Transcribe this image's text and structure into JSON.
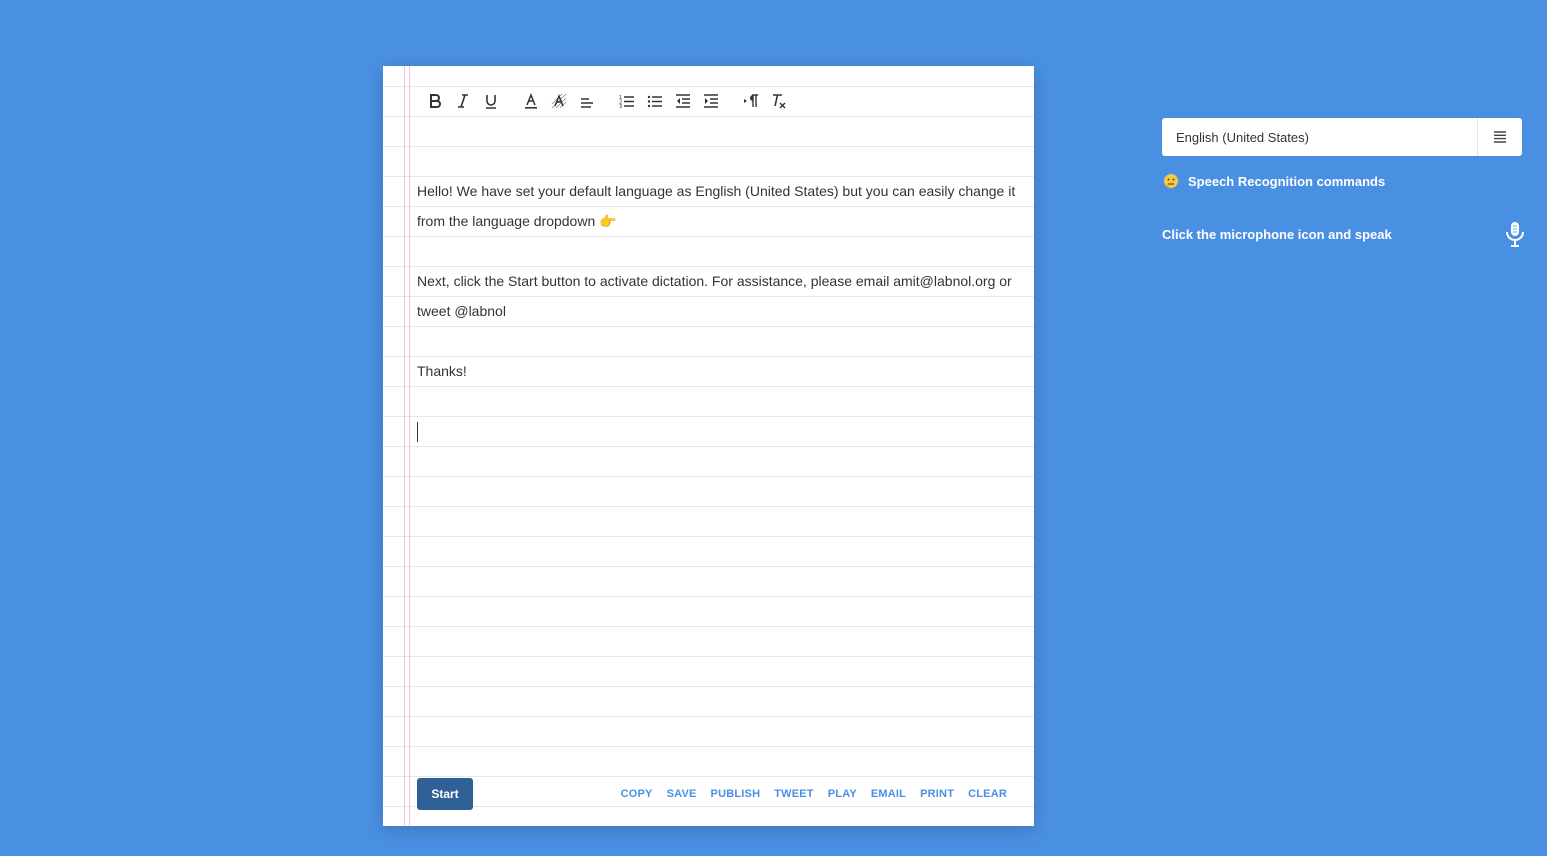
{
  "toolbar": {
    "buttons": [
      {
        "name": "bold-icon"
      },
      {
        "name": "italic-icon"
      },
      {
        "name": "underline-icon"
      },
      {
        "name": "font-color-icon"
      },
      {
        "name": "background-color-icon"
      },
      {
        "name": "align-icon"
      },
      {
        "name": "ordered-list-icon"
      },
      {
        "name": "bullet-list-icon"
      },
      {
        "name": "outdent-icon"
      },
      {
        "name": "indent-icon"
      },
      {
        "name": "text-direction-icon"
      },
      {
        "name": "clear-format-icon"
      }
    ]
  },
  "editor": {
    "paragraph1": "Hello! We have set your default language as English (United States) but you can easily change it from the language dropdown",
    "paragraph1_emoji": "👉",
    "paragraph2": "Next, click the Start button to activate dictation. For assistance, please email amit@labnol.org or tweet @labnol",
    "paragraph3": "Thanks!"
  },
  "bottom": {
    "start_label": "Start",
    "actions": [
      "COPY",
      "SAVE",
      "PUBLISH",
      "TWEET",
      "PLAY",
      "EMAIL",
      "PRINT",
      "CLEAR"
    ]
  },
  "sidebar": {
    "language_value": "English (United States)",
    "commands_label": "Speech Recognition commands",
    "hint": "Click the microphone icon and speak"
  },
  "colors": {
    "background": "#4a90e2",
    "start_button": "#2f6197",
    "action_link": "#4a90e2"
  }
}
